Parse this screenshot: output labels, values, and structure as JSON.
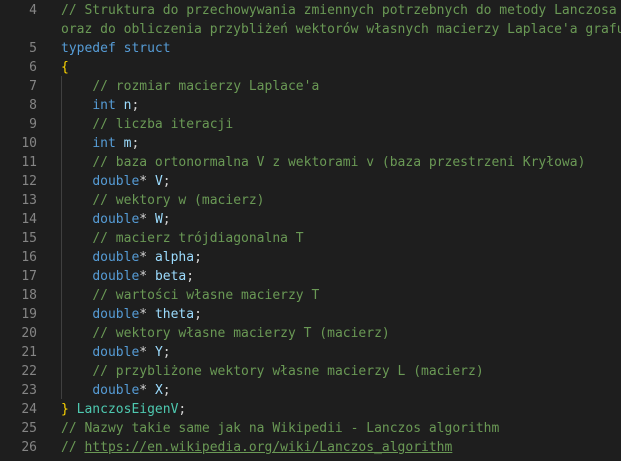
{
  "editor": {
    "lines": [
      {
        "num": "4",
        "tokens": [
          {
            "t": "// Struktura do przechowywania zmiennych potrzebnych do metody Lanczosa",
            "c": "c-comment"
          }
        ]
      },
      {
        "num": "",
        "tokens": [
          {
            "t": "oraz do obliczenia przybliżeń wektorów własnych macierzy Laplace'a grafu",
            "c": "c-comment"
          }
        ]
      },
      {
        "num": "5",
        "tokens": [
          {
            "t": "typedef",
            "c": "c-keyword"
          },
          {
            "t": " ",
            "c": "c-plain"
          },
          {
            "t": "struct",
            "c": "c-keyword"
          }
        ]
      },
      {
        "num": "6",
        "tokens": [
          {
            "t": "{",
            "c": "c-brace"
          }
        ]
      },
      {
        "num": "7",
        "tokens": [
          {
            "t": "    ",
            "c": "c-plain"
          },
          {
            "t": "// rozmiar macierzy Laplace'a",
            "c": "c-comment"
          }
        ]
      },
      {
        "num": "8",
        "tokens": [
          {
            "t": "    ",
            "c": "c-plain"
          },
          {
            "t": "int",
            "c": "c-keyword"
          },
          {
            "t": " ",
            "c": "c-plain"
          },
          {
            "t": "n",
            "c": "c-var"
          },
          {
            "t": ";",
            "c": "c-plain"
          }
        ]
      },
      {
        "num": "9",
        "tokens": [
          {
            "t": "    ",
            "c": "c-plain"
          },
          {
            "t": "// liczba iteracji",
            "c": "c-comment"
          }
        ]
      },
      {
        "num": "10",
        "tokens": [
          {
            "t": "    ",
            "c": "c-plain"
          },
          {
            "t": "int",
            "c": "c-keyword"
          },
          {
            "t": " ",
            "c": "c-plain"
          },
          {
            "t": "m",
            "c": "c-var"
          },
          {
            "t": ";",
            "c": "c-plain"
          }
        ]
      },
      {
        "num": "11",
        "tokens": [
          {
            "t": "    ",
            "c": "c-plain"
          },
          {
            "t": "// baza ortonormalna V z wektorami v (baza przestrzeni Kryłowa)",
            "c": "c-comment"
          }
        ]
      },
      {
        "num": "12",
        "tokens": [
          {
            "t": "    ",
            "c": "c-plain"
          },
          {
            "t": "double",
            "c": "c-keyword"
          },
          {
            "t": "* ",
            "c": "c-plain"
          },
          {
            "t": "V",
            "c": "c-var"
          },
          {
            "t": ";",
            "c": "c-plain"
          }
        ]
      },
      {
        "num": "13",
        "tokens": [
          {
            "t": "    ",
            "c": "c-plain"
          },
          {
            "t": "// wektory w (macierz)",
            "c": "c-comment"
          }
        ]
      },
      {
        "num": "14",
        "tokens": [
          {
            "t": "    ",
            "c": "c-plain"
          },
          {
            "t": "double",
            "c": "c-keyword"
          },
          {
            "t": "* ",
            "c": "c-plain"
          },
          {
            "t": "W",
            "c": "c-var"
          },
          {
            "t": ";",
            "c": "c-plain"
          }
        ]
      },
      {
        "num": "15",
        "tokens": [
          {
            "t": "    ",
            "c": "c-plain"
          },
          {
            "t": "// macierz trójdiagonalna T",
            "c": "c-comment"
          }
        ]
      },
      {
        "num": "16",
        "tokens": [
          {
            "t": "    ",
            "c": "c-plain"
          },
          {
            "t": "double",
            "c": "c-keyword"
          },
          {
            "t": "* ",
            "c": "c-plain"
          },
          {
            "t": "alpha",
            "c": "c-var"
          },
          {
            "t": ";",
            "c": "c-plain"
          }
        ]
      },
      {
        "num": "17",
        "tokens": [
          {
            "t": "    ",
            "c": "c-plain"
          },
          {
            "t": "double",
            "c": "c-keyword"
          },
          {
            "t": "* ",
            "c": "c-plain"
          },
          {
            "t": "beta",
            "c": "c-var"
          },
          {
            "t": ";",
            "c": "c-plain"
          }
        ]
      },
      {
        "num": "18",
        "tokens": [
          {
            "t": "    ",
            "c": "c-plain"
          },
          {
            "t": "// wartości własne macierzy T",
            "c": "c-comment"
          }
        ]
      },
      {
        "num": "19",
        "tokens": [
          {
            "t": "    ",
            "c": "c-plain"
          },
          {
            "t": "double",
            "c": "c-keyword"
          },
          {
            "t": "* ",
            "c": "c-plain"
          },
          {
            "t": "theta",
            "c": "c-var"
          },
          {
            "t": ";",
            "c": "c-plain"
          }
        ]
      },
      {
        "num": "20",
        "tokens": [
          {
            "t": "    ",
            "c": "c-plain"
          },
          {
            "t": "// wektory własne macierzy T (macierz)",
            "c": "c-comment"
          }
        ]
      },
      {
        "num": "21",
        "tokens": [
          {
            "t": "    ",
            "c": "c-plain"
          },
          {
            "t": "double",
            "c": "c-keyword"
          },
          {
            "t": "* ",
            "c": "c-plain"
          },
          {
            "t": "Y",
            "c": "c-var"
          },
          {
            "t": ";",
            "c": "c-plain"
          }
        ]
      },
      {
        "num": "22",
        "tokens": [
          {
            "t": "    ",
            "c": "c-plain"
          },
          {
            "t": "// przybliżone wektory własne macierzy L (macierz)",
            "c": "c-comment"
          }
        ]
      },
      {
        "num": "23",
        "tokens": [
          {
            "t": "    ",
            "c": "c-plain"
          },
          {
            "t": "double",
            "c": "c-keyword"
          },
          {
            "t": "* ",
            "c": "c-plain"
          },
          {
            "t": "X",
            "c": "c-var"
          },
          {
            "t": ";",
            "c": "c-plain"
          }
        ]
      },
      {
        "num": "24",
        "tokens": [
          {
            "t": "}",
            "c": "c-brace"
          },
          {
            "t": " ",
            "c": "c-plain"
          },
          {
            "t": "LanczosEigenV",
            "c": "c-type"
          },
          {
            "t": ";",
            "c": "c-plain"
          }
        ]
      },
      {
        "num": "25",
        "tokens": [
          {
            "t": "// Nazwy takie same jak na Wikipedii - Lanczos algorithm",
            "c": "c-comment"
          }
        ]
      },
      {
        "num": "26",
        "tokens": [
          {
            "t": "// ",
            "c": "c-comment"
          },
          {
            "t": "https://en.wikipedia.org/wiki/Lanczos_algorithm",
            "c": "c-link"
          }
        ]
      }
    ]
  }
}
